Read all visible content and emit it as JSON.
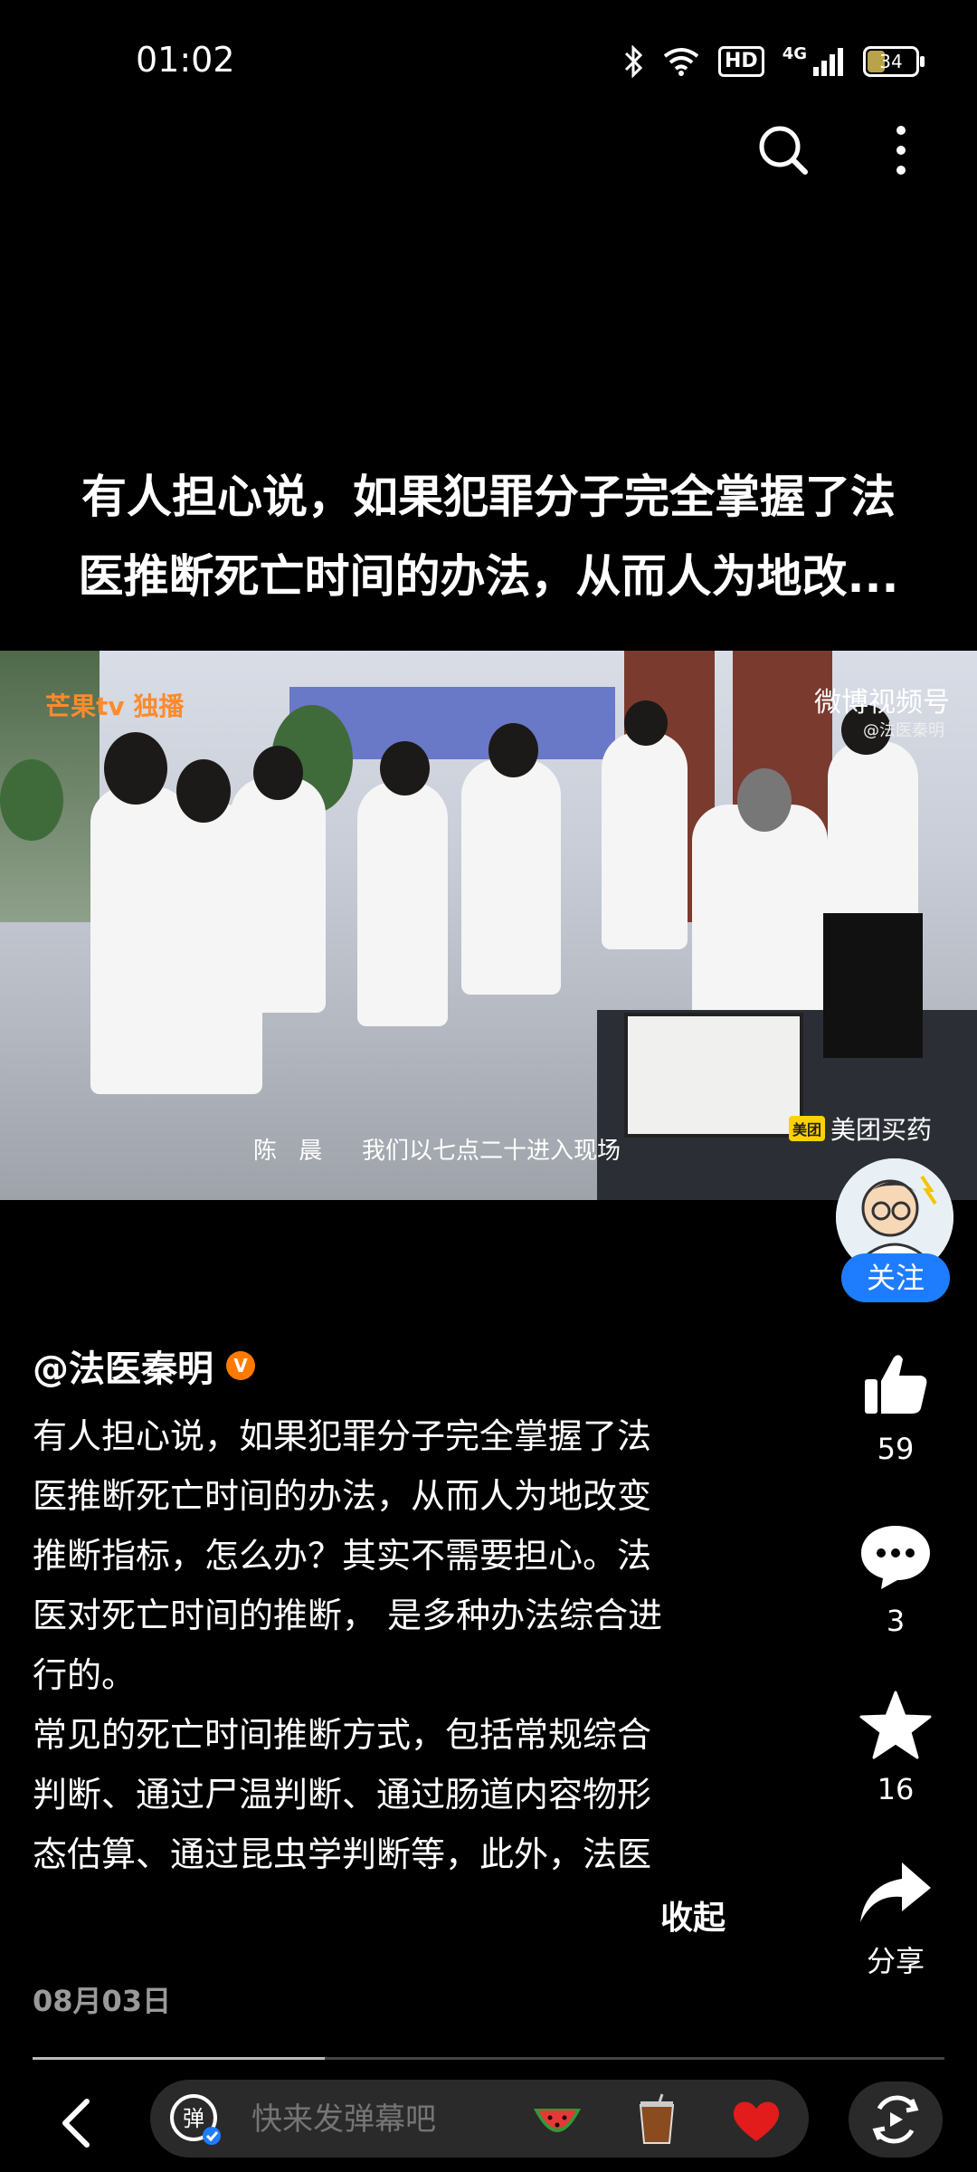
{
  "status_bar": {
    "time": "01:02",
    "hd_label": "HD",
    "network_label": "4G",
    "battery_level": "34",
    "battery_fraction": 0.34
  },
  "top_actions": {
    "search_icon": "search-icon",
    "more_icon": "more-vertical-icon"
  },
  "headline": {
    "line1": "有人担心说，如果犯罪分子完全掌握了法",
    "line2": "医推断死亡时间的办法，从而人为地改..."
  },
  "video": {
    "watermark_left": "芒果tv 独播",
    "watermark_right": "微博视频号",
    "watermark_handle": "@法医秦明",
    "subtitle_name": "陈 晨",
    "subtitle_text": "我们以七点二十进入现场",
    "ad_logo": "美团",
    "ad_text": "美团买药"
  },
  "author": {
    "name": "@法医秦明",
    "verified": "V",
    "follow_label": "关注"
  },
  "description": {
    "lines": [
      "有人担心说，如果犯罪分子完全掌握了法",
      "医推断死亡时间的办法，从而人为地改变",
      "推断指标，怎么办？其实不需要担心。法",
      "医对死亡时间的推断， 是多种办法综合进",
      "行的。",
      "常见的死亡时间推断方式，包括常规综合",
      "判断、通过尸温判断、通过肠道内容物形",
      "态估算、通过昆虫学判断等，此外，法医"
    ],
    "collapse_label": "收起",
    "date": "08月03日"
  },
  "actions": {
    "like_count": "59",
    "comment_count": "3",
    "favorite_count": "16",
    "share_label": "分享"
  },
  "playback": {
    "progress_fraction": 0.32
  },
  "bottom_bar": {
    "danmaku_toggle_label": "弹",
    "danmaku_placeholder": "快来发弹幕吧",
    "emojis": [
      "watermelon-emoji",
      "drink-emoji",
      "heart-emoji"
    ]
  }
}
